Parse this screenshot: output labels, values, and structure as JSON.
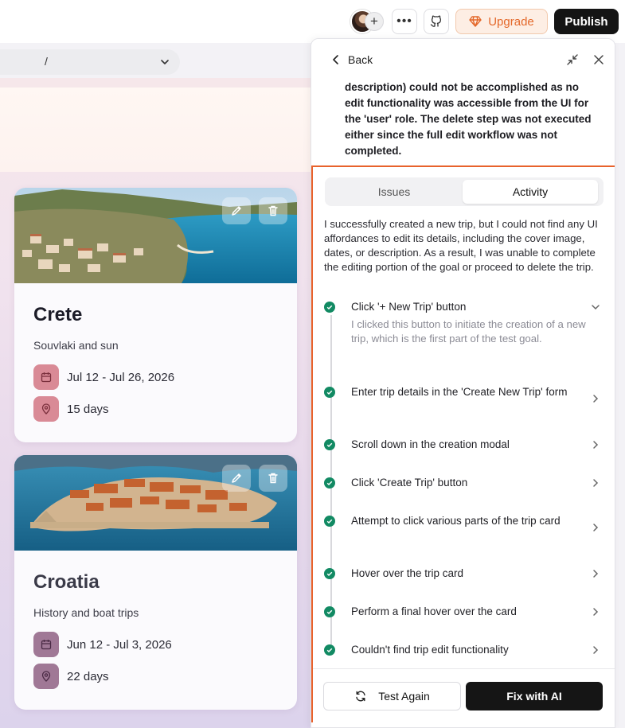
{
  "topbar": {
    "upgrade_label": "Upgrade",
    "publish_label": "Publish",
    "add_collaborator_symbol": "+",
    "more_symbol": "•••",
    "brand_accent": "#e4682a"
  },
  "urlbar": {
    "path": "/"
  },
  "trips": [
    {
      "title": "Crete",
      "subtitle": "Souvlaki and sun",
      "dates": "Jul 12 - Jul 26, 2026",
      "duration": "15 days",
      "icon_tint": "#d98a96"
    },
    {
      "title": "Croatia",
      "subtitle": "History and boat trips",
      "dates": "Jun 12 - Jul 3, 2026",
      "duration": "22 days",
      "icon_tint": "#a07896"
    }
  ],
  "panel": {
    "back_label": "Back",
    "description": "description) could not be accomplished as no edit functionality was accessible from the UI for the 'user' role. The delete step was not executed either since the full edit workflow was not completed.",
    "tabs": {
      "issues": "Issues",
      "activity": "Activity",
      "active": "Activity"
    },
    "summary": "I successfully created a new trip, but I could not find any UI affordances to edit its details, including the cover image, dates, or description. As a result, I was unable to complete the editing portion of the goal or proceed to delete the trip.",
    "steps": [
      {
        "label": "Click '+ New Trip' button",
        "detail": "I clicked this button to initiate the creation of a new trip, which is the first part of the test goal.",
        "expanded": true
      },
      {
        "label": "Enter trip details in the 'Create New Trip' form"
      },
      {
        "label": "Scroll down in the creation modal"
      },
      {
        "label": "Click 'Create Trip' button"
      },
      {
        "label": "Attempt to click various parts of the trip card"
      },
      {
        "label": "Hover over the trip card"
      },
      {
        "label": "Perform a final hover over the card"
      },
      {
        "label": "Couldn't find trip edit functionality"
      }
    ],
    "test_again_label": "Test Again",
    "fix_ai_label": "Fix with AI",
    "step_status_color": "#128a63",
    "highlight_color": "#e8622c"
  }
}
